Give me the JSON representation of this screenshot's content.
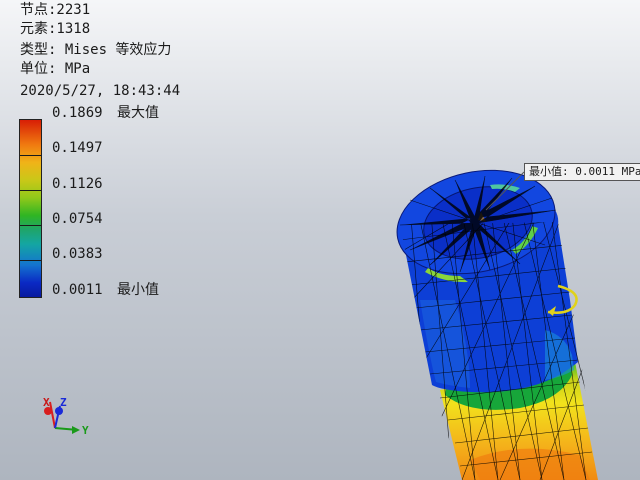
{
  "info": {
    "nodes": "节点:2231",
    "elements": "元素:1318",
    "type": "类型: Mises 等效应力",
    "unit": "单位: MPa",
    "datetime": "2020/5/27, 18:43:44"
  },
  "legend": {
    "max_value": "0.1869",
    "max_label": "最大值",
    "v2": "0.1497",
    "v3": "0.1126",
    "v4": "0.0754",
    "v5": "0.0383",
    "min_value": "0.0011",
    "min_label": "最小值"
  },
  "min_tag": "最小值: 0.0011 MPa",
  "axes": {
    "x": "X",
    "y": "Y",
    "z": "Z"
  },
  "colors": {
    "max": "#d81e05",
    "mid": "#2fb523",
    "min": "#081a9e",
    "mesh": "#000000"
  }
}
